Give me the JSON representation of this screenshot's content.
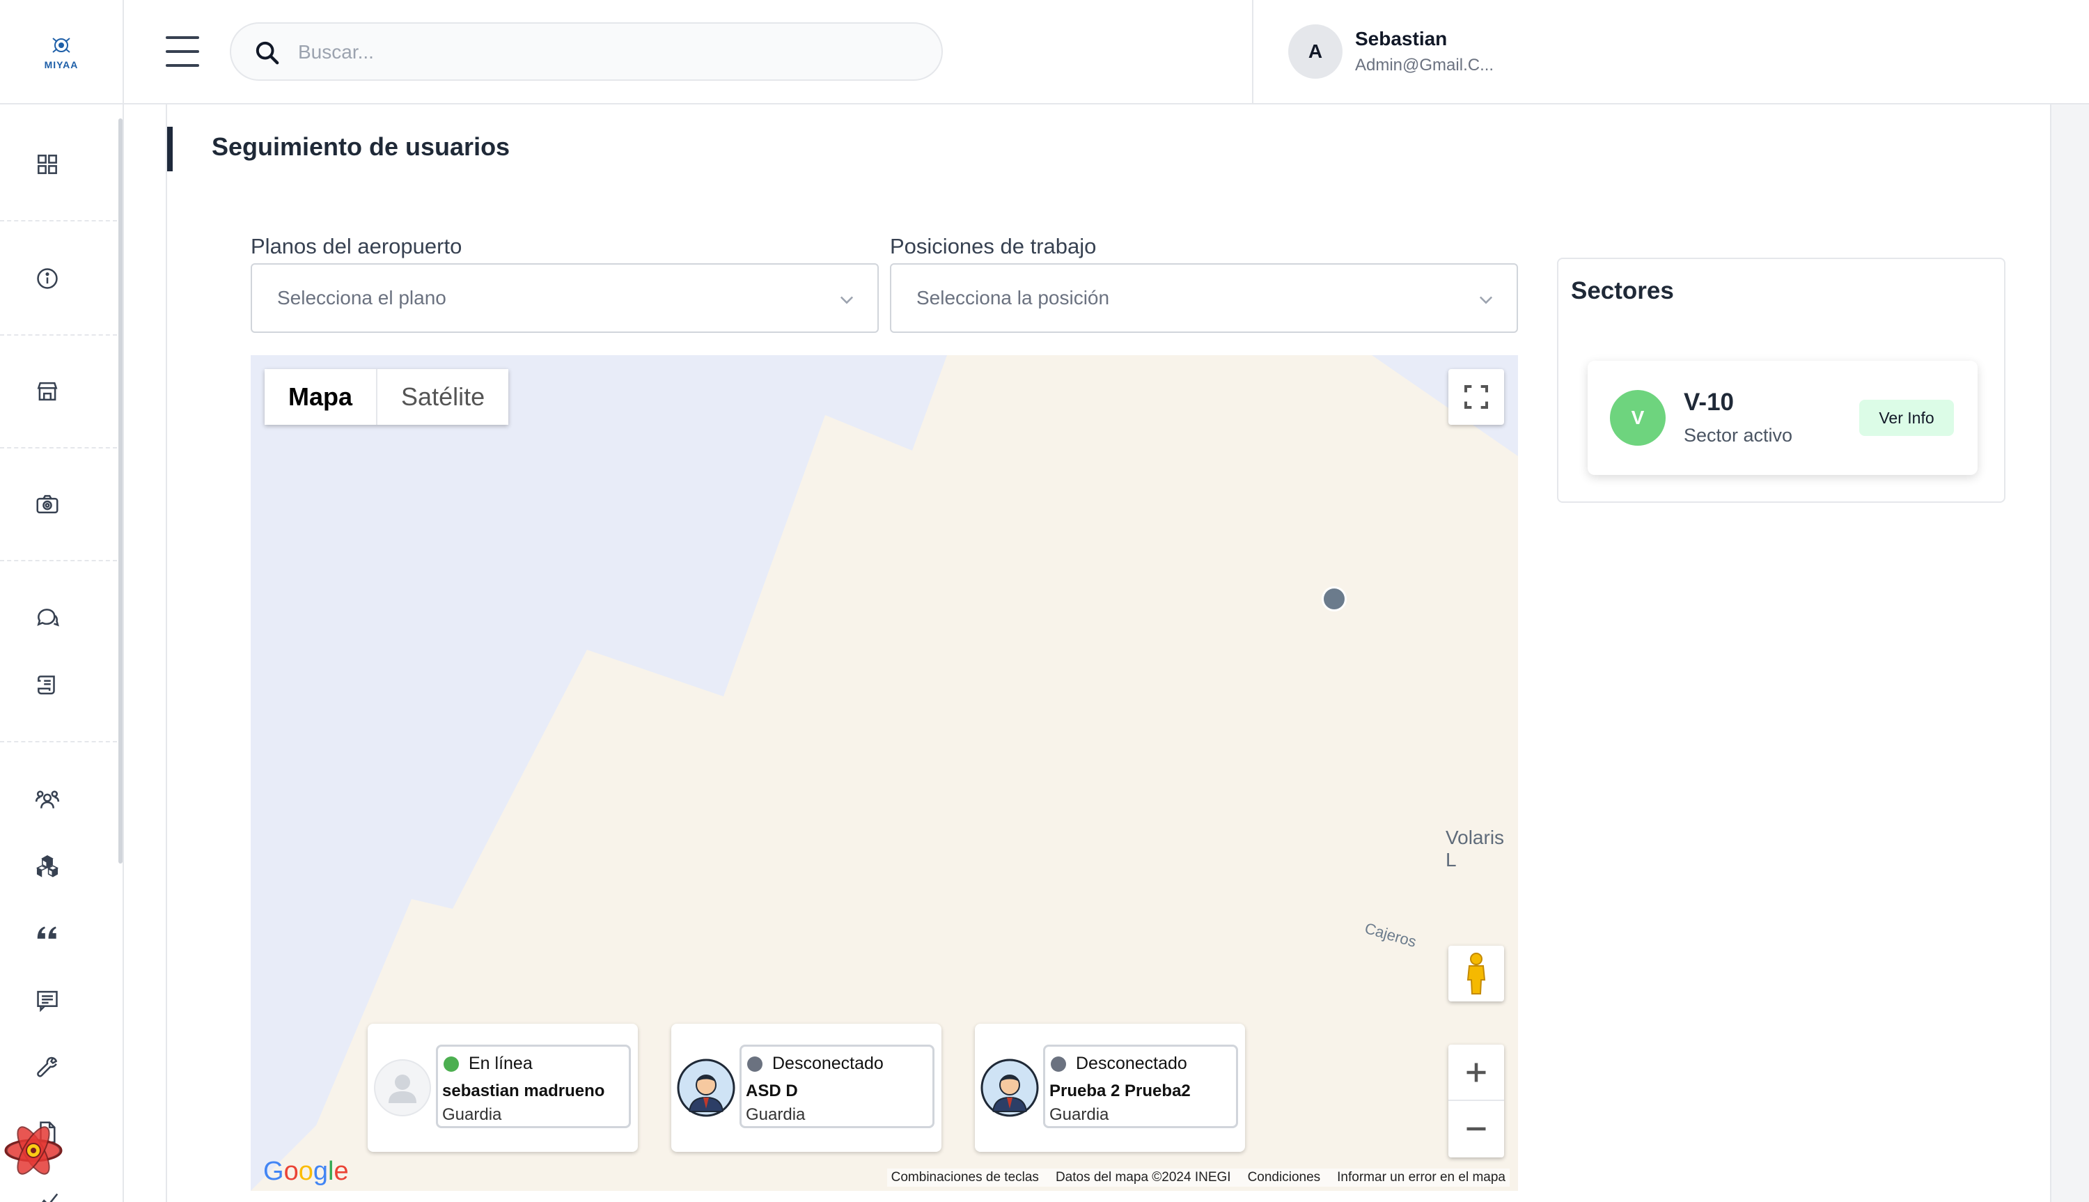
{
  "app": {
    "logo_text": "MIYAA"
  },
  "search": {
    "placeholder": "Buscar..."
  },
  "user": {
    "initial": "A",
    "name": "Sebastian",
    "email": "Admin@Gmail.C..."
  },
  "sidebar": {
    "items": [
      {
        "icon": "grid-icon"
      },
      {
        "icon": "info-icon"
      },
      {
        "icon": "store-icon"
      },
      {
        "icon": "camera-icon"
      },
      {
        "icon": "chat-icon"
      },
      {
        "icon": "scroll-icon"
      },
      {
        "icon": "users-icon"
      },
      {
        "icon": "boxes-icon"
      },
      {
        "icon": "quote-icon"
      },
      {
        "icon": "message-icon"
      },
      {
        "icon": "wrench-icon"
      },
      {
        "icon": "document-icon"
      }
    ]
  },
  "page": {
    "title": "Seguimiento de usuarios"
  },
  "filters": {
    "plano": {
      "label": "Planos del aeropuerto",
      "placeholder": "Selecciona el plano"
    },
    "posicion": {
      "label": "Posiciones de trabajo",
      "placeholder": "Selecciona la posición"
    }
  },
  "map": {
    "type_map": "Mapa",
    "type_satellite": "Satélite",
    "labels": {
      "cajeros": "Cajeros",
      "volaris": "Volaris L"
    },
    "footer": {
      "shortcuts": "Combinaciones de teclas",
      "data": "Datos del mapa ©2024 INEGI",
      "terms": "Condiciones",
      "report": "Informar un error en el mapa"
    },
    "google": "Google"
  },
  "users": [
    {
      "status": "En línea",
      "status_color": "#4caf50",
      "name": "sebastian madrueno",
      "role": "Guardia",
      "avatar": "placeholder"
    },
    {
      "status": "Desconectado",
      "status_color": "#6b7280",
      "name": "ASD D",
      "role": "Guardia",
      "avatar": "guard"
    },
    {
      "status": "Desconectado",
      "status_color": "#6b7280",
      "name": "Prueba 2 Prueba2",
      "role": "Guardia",
      "avatar": "guard"
    }
  ],
  "sectores": {
    "title": "Sectores",
    "items": [
      {
        "initial": "V",
        "name": "V-10",
        "status": "Sector activo",
        "button": "Ver Info"
      }
    ]
  }
}
